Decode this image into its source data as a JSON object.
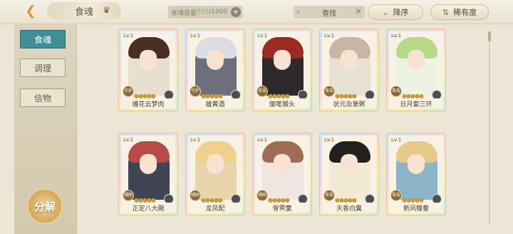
{
  "topbar": {
    "title": "食魂",
    "capacity_label": "食魂容量",
    "capacity_current": "555",
    "capacity_max": "/1000",
    "search_placeholder": "查找",
    "sort_label": "降序",
    "rarity_label": "稀有度"
  },
  "sidebar": {
    "tabs": [
      {
        "label": "食魂",
        "active": true
      },
      {
        "label": "调理",
        "active": false
      },
      {
        "label": "信物",
        "active": false
      }
    ],
    "decompose_label": "分解"
  },
  "cards": [
    {
      "level": "Lv.1",
      "name": "缠花云梦肉",
      "role": "守护",
      "hair": "#4a2f26",
      "robe": "#e8dfcf"
    },
    {
      "level": "Lv.1",
      "name": "雄黄酒",
      "role": "守护",
      "hair": "#dcdde2",
      "robe": "#6d6f7c"
    },
    {
      "level": "Lv.1",
      "name": "御笔猴头",
      "role": "攻击",
      "hair": "#9a2a22",
      "robe": "#2e2a2c"
    },
    {
      "level": "Lv.1",
      "name": "状元及第粥",
      "role": "攻击",
      "hair": "#c9b5a4",
      "robe": "#e7e1d3"
    },
    {
      "level": "Lv.1",
      "name": "日月套三环",
      "role": "攻击",
      "hair": "#b6d98a",
      "robe": "#eef2e3"
    },
    {
      "level": "Lv.1",
      "name": "正定八大碗",
      "role": "辅助",
      "hair": "#b84a48",
      "robe": "#3f4552"
    },
    {
      "level": "Lv.1",
      "name": "龙凤配",
      "role": "辅助",
      "hair": "#f0d08a",
      "robe": "#e8d5ac"
    },
    {
      "level": "Lv.1",
      "name": "雪霁羹",
      "role": "辅助",
      "hair": "#a06c55",
      "robe": "#f1e5e2"
    },
    {
      "level": "Lv.1",
      "name": "天香白糞",
      "role": "攻击",
      "hair": "#22201f",
      "robe": "#f2ead4"
    },
    {
      "level": "Lv.1",
      "name": "新风鳗鲞",
      "role": "攻击",
      "hair": "#e8c98a",
      "robe": "#8ab5c8"
    }
  ]
}
